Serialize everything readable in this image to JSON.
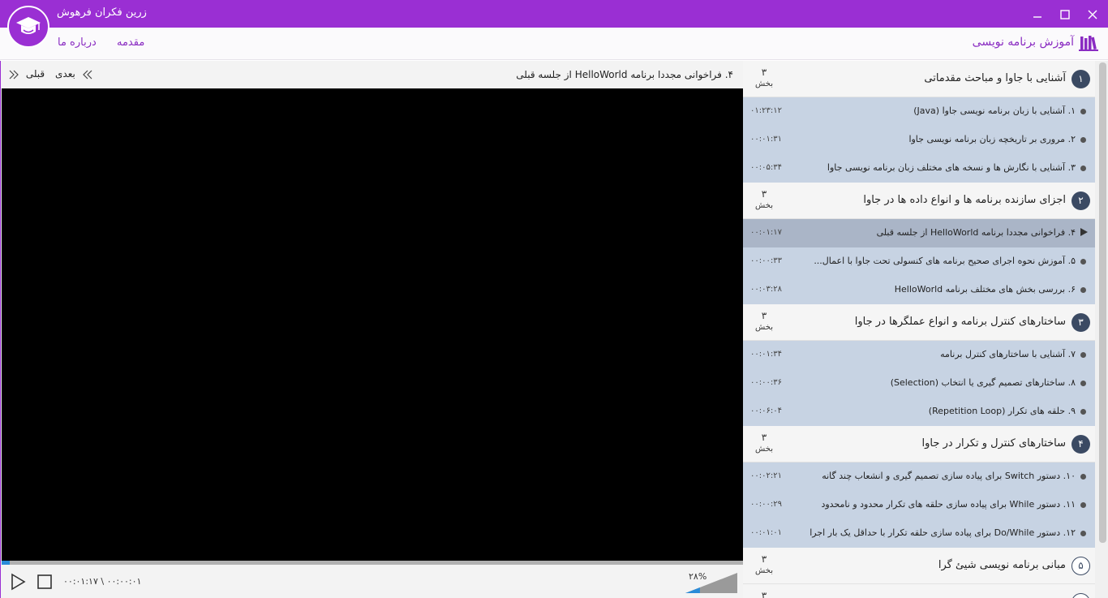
{
  "app": {
    "title": "زرین فکران فرهوش",
    "name": "آموزش برنامه نویسی"
  },
  "menu": {
    "about": "درباره ما",
    "intro": "مقدمه"
  },
  "window_controls": {
    "minimize": "—",
    "maximize": "☐",
    "close": "✕"
  },
  "player": {
    "current_title": "۴. فراخوانی مجددا برنامه HelloWorld از جلسه قبلی",
    "next_label": "بعدی",
    "prev_label": "قبلی",
    "time_text": "۰۰:۰۰:۰۱ \\ ۰۰:۰۱:۱۷",
    "volume": "۲۸%",
    "volume_fraction": 0.28,
    "progress_fraction": 0.011
  },
  "playlist": {
    "count_unit": "بخش",
    "sections": [
      {
        "num": "۱",
        "title": "آشنایی با جاوا و مباحث مقدماتی",
        "count": "۳"
      },
      {
        "num": "۲",
        "title": "اجزای سازنده برنامه ها و انواع داده ها در جاوا",
        "count": "۳"
      },
      {
        "num": "۳",
        "title": "ساختارهای کنترل برنامه و انواع عملگرها در جاوا",
        "count": "۳"
      },
      {
        "num": "۴",
        "title": "ساختارهای کنترل و تکرار در جاوا",
        "count": "۳"
      },
      {
        "num": "۵",
        "title": "مبانی برنامه نویسی شیئ گرا",
        "count": "۳"
      },
      {
        "num": "",
        "title": "",
        "count": "۳"
      }
    ],
    "items": [
      {
        "title": "۱. آشنایی با زبان برنامه نویسی جاوا (Java)",
        "duration": "۰۱:۲۳:۱۲"
      },
      {
        "title": "۲. مروری بر تاریخچه زبان برنامه نویسی جاوا",
        "duration": "۰۰:۰۱:۳۱"
      },
      {
        "title": "۳. آشنایی با نگارش ها و نسخه های مختلف زبان برنامه نویسی جاوا",
        "duration": "۰۰:۰۵:۳۴"
      },
      {
        "title": "۴. فراخوانی مجددا برنامه HelloWorld از جلسه قبلی",
        "duration": "۰۰:۰۱:۱۷"
      },
      {
        "title": "۵. آموزش نحوه اجرای صحیح برنامه های کنسولی تحت جاوا با اعمال...",
        "duration": "۰۰:۰۰:۳۳"
      },
      {
        "title": "۶. بررسی بخش های مختلف برنامه HelloWorld",
        "duration": "۰۰:۰۳:۲۸"
      },
      {
        "title": "۷. آشنایی با ساختارهای کنترل برنامه",
        "duration": "۰۰:۰۱:۳۴"
      },
      {
        "title": "۸. ساختارهای تصمیم گیری یا انتخاب (Selection)",
        "duration": "۰۰:۰۰:۳۶"
      },
      {
        "title": "۹. حلقه های تکرار (Repetition Loop)",
        "duration": "۰۰:۰۶:۰۴"
      },
      {
        "title": "۱۰. دستور Switch برای پیاده سازی تصمیم گیری و انشعاب چند گانه",
        "duration": "۰۰:۰۲:۲۱"
      },
      {
        "title": "۱۱. دستور While برای پیاده سازی حلقه های تکرار محدود و نامحدود",
        "duration": "۰۰:۰۰:۲۹"
      },
      {
        "title": "۱۲. دستور Do/While برای پیاده سازی حلقه تکرار با حداقل یک بار اجرا",
        "duration": "۰۰:۰۱:۰۱"
      }
    ]
  },
  "colors": {
    "brand": "#9a2fd3",
    "badge": "#3b4a63",
    "item_bg": "#c7d3e3",
    "item_active": "#aab5c7",
    "progress": "#2a8bd8"
  }
}
